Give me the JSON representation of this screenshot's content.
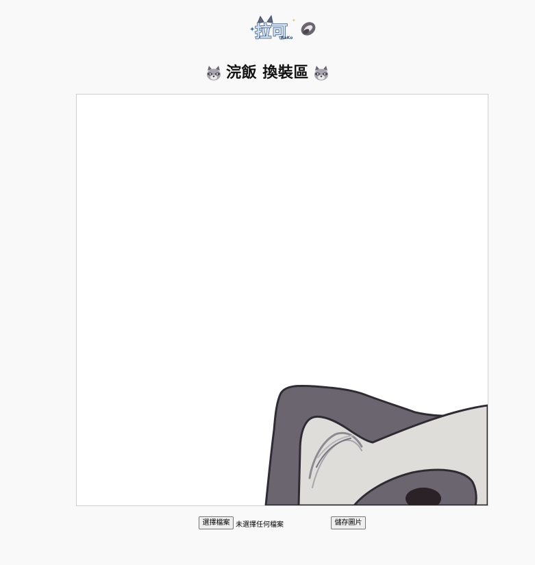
{
  "header": {
    "logo_text": "拉可",
    "logo_subtext": "RaKo",
    "title": "浣飯 換裝區"
  },
  "editor": {
    "canvas_content": "raccoon-ear-artwork"
  },
  "controls": {
    "file_button_label": "選擇檔案",
    "file_status": "未選擇任何檔案",
    "save_button_label": "儲存圖片"
  },
  "colors": {
    "page_background": "#f9f9f9",
    "canvas_background": "#ffffff",
    "raccoon_dark": "#6b6570",
    "raccoon_light": "#dfddd9",
    "logo_blue": "#3d6fb3"
  }
}
